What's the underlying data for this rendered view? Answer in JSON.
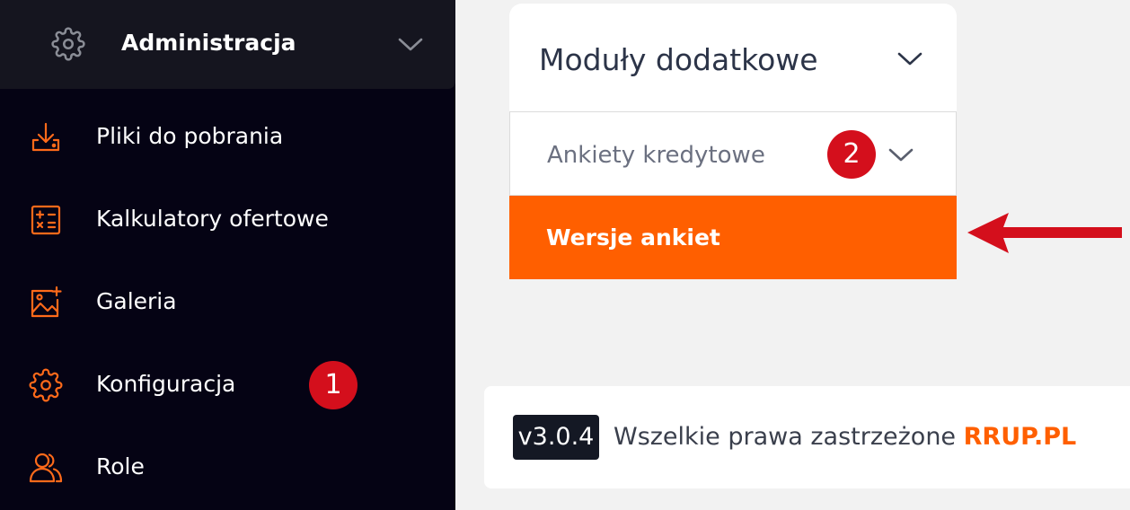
{
  "sidebar": {
    "header": {
      "title": "Administracja",
      "icon": "gear-icon",
      "chevron": "chevron-down-icon"
    },
    "items": [
      {
        "label": "Pliki do pobrania",
        "icon": "download-icon"
      },
      {
        "label": "Kalkulatory ofertowe",
        "icon": "calculator-icon"
      },
      {
        "label": "Galeria",
        "icon": "gallery-icon"
      },
      {
        "label": "Konfiguracja",
        "icon": "gear-icon",
        "badge": "1"
      },
      {
        "label": "Role",
        "icon": "users-icon"
      }
    ]
  },
  "main": {
    "panel": {
      "title": "Moduły dodatkowe",
      "submenu": {
        "label": "Ankiety kredytowe",
        "badge": "2",
        "active_item": "Wersje ankiet"
      }
    },
    "footer": {
      "version": "v3.0.4",
      "rights": "Wszelkie prawa zastrzeżone ",
      "brand": "RRUP.PL"
    }
  },
  "colors": {
    "accent": "#ff5f00",
    "sidebar_bg": "#050314",
    "badge": "#d40f1c",
    "arrow": "#d40f1c"
  }
}
